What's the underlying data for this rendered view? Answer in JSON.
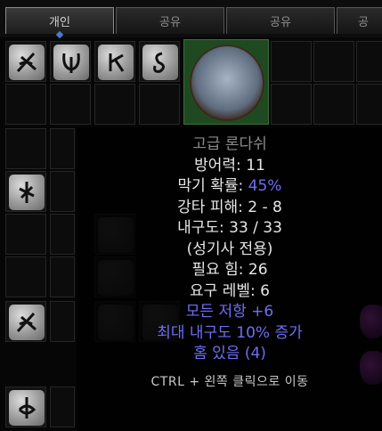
{
  "tabs": [
    {
      "label": "개인",
      "active": true
    },
    {
      "label": "공유",
      "active": false
    },
    {
      "label": "공유",
      "active": false
    },
    {
      "label": "공",
      "active": false
    }
  ],
  "item_tooltip": {
    "name": "고급 론다쉬",
    "defense_label": "방어력:",
    "defense_value": "11",
    "block_label": "막기 확률:",
    "block_value": "45%",
    "smite_label": "강타 피해:",
    "smite_value": "2 - 8",
    "durability_label": "내구도:",
    "durability_value": "33 / 33",
    "class_only": "(성기사 전용)",
    "req_str": "필요 힘: 26",
    "req_level": "요구 레벨: 6",
    "mod_resist": "모든 저항 +6",
    "mod_durability": "최대 내구도 10% 증가",
    "sockets": "홈 있음 (4)",
    "hint": "CTRL + 왼쪽 클릭으로 이동"
  },
  "icons": {
    "item": "paladin-shield-icon",
    "rune": "rune-stone-icon",
    "potion": "rejuvenation-potion-icon"
  },
  "colors": {
    "item_name": "#8a8a8a",
    "text": "#e6e6e6",
    "magic": "#6e6ef5",
    "equipped_bg": "#1f4a21"
  }
}
